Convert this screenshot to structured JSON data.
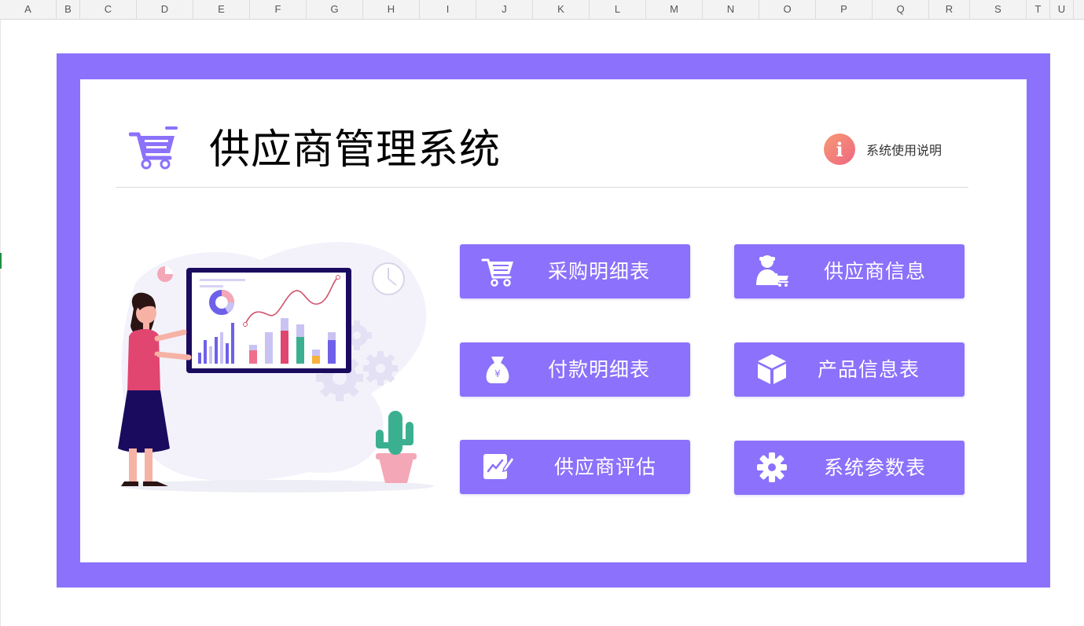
{
  "spreadsheet": {
    "columns": [
      "A",
      "B",
      "C",
      "D",
      "E",
      "F",
      "G",
      "H",
      "I",
      "J",
      "K",
      "L",
      "M",
      "N",
      "O",
      "P",
      "Q",
      "R",
      "S",
      "T",
      "U"
    ]
  },
  "header": {
    "title": "供应商管理系统",
    "help_label": "系统使用说明",
    "help_icon": "info-icon"
  },
  "colors": {
    "accent": "#8b71fb",
    "help_gradient_start": "#f59a74",
    "help_gradient_end": "#f06682"
  },
  "menu": [
    {
      "label": "采购明细表",
      "icon": "cart-icon"
    },
    {
      "label": "供应商信息",
      "icon": "supplier-icon"
    },
    {
      "label": "付款明细表",
      "icon": "money-bag-icon"
    },
    {
      "label": "产品信息表",
      "icon": "box-icon"
    },
    {
      "label": "供应商评估",
      "icon": "edit-icon"
    },
    {
      "label": "系统参数表",
      "icon": "gear-icon"
    }
  ],
  "illustration": {
    "money_symbol": "¥"
  }
}
